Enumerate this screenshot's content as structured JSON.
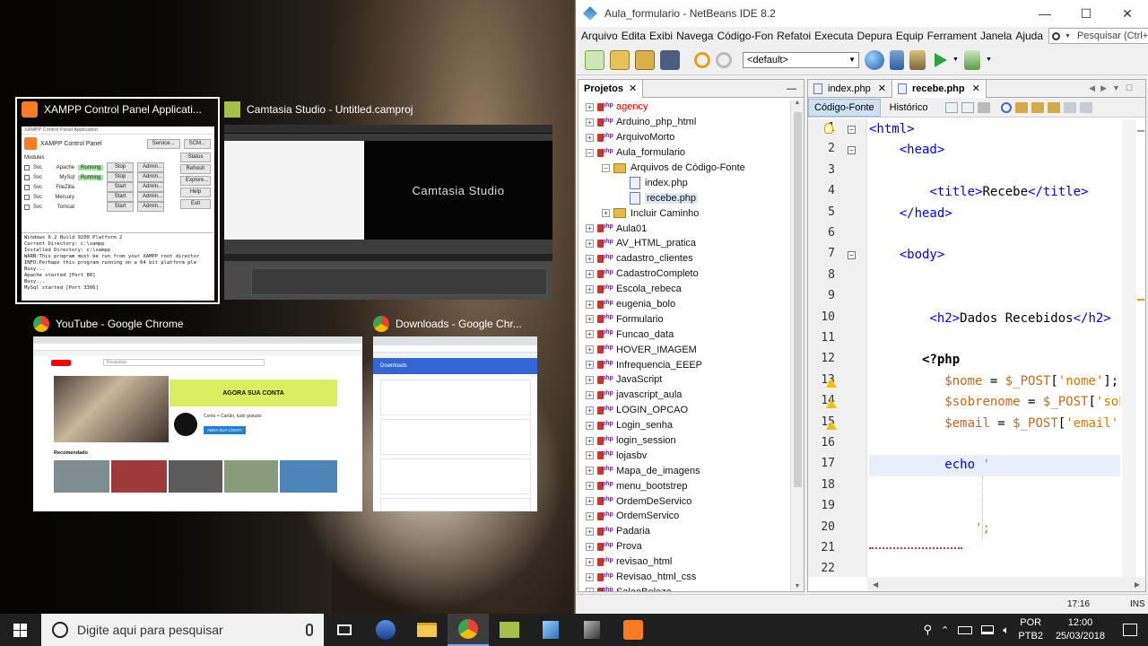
{
  "task_view": {
    "xampp": {
      "title": "XAMPP Control Panel Applicati...",
      "inner_title": "XAMPP Control Panel Application",
      "panel_label": "XAMPP Control Panel",
      "service_btn": "Service...",
      "scm_btn": "SCM...",
      "modules_label": "Modules",
      "svc": "Svc",
      "side_buttons": [
        "Status",
        "Refresh",
        "Explore...",
        "Help",
        "Exit"
      ],
      "modules": [
        {
          "name": "Apache",
          "status": "Running",
          "action": "Stop",
          "admin": "Admin..."
        },
        {
          "name": "MySql",
          "status": "Running",
          "action": "Stop",
          "admin": "Admin..."
        },
        {
          "name": "FileZilla",
          "status": "",
          "action": "Start",
          "admin": "Admin..."
        },
        {
          "name": "Mercury",
          "status": "",
          "action": "Start",
          "admin": "Admin..."
        },
        {
          "name": "Tomcat",
          "status": "",
          "action": "Start",
          "admin": "Admin..."
        }
      ],
      "log": [
        "Windows 6.2 Build 9200 Platform 2",
        "Current Directory: c:\\xampp",
        "Installed Directory: c:\\xampp",
        "WARN:This program must be run from your XAMPP root director",
        "INFO:Perhaps this program running on a 64 bit platform ple",
        "Busy...",
        "Apache started [Port 80]",
        "Busy...",
        "MySql started [Port 3306]"
      ]
    },
    "camtasia": {
      "title": "Camtasia Studio - Untitled.camproj",
      "logo": "Camtasia Studio"
    },
    "youtube": {
      "title": "YouTube - Google Chrome",
      "search_placeholder": "Pesquisar",
      "banner": "AGORA SUA CONTA",
      "promo": "Conta + Cartão, tudo gratuito",
      "cta": "ABRA SUA CONTA",
      "section": "Recomendado"
    },
    "downloads": {
      "title": "Downloads - Google Chr...",
      "header": "Downloads"
    }
  },
  "netbeans": {
    "title": "Aula_formulario - NetBeans IDE 8.2",
    "window_controls": [
      "—",
      "☐",
      "✕"
    ],
    "menu": [
      "Arquivo",
      "Editar",
      "Exibir",
      "Navegar",
      "Código-Fonte",
      "Refatorar",
      "Executar",
      "Depurar",
      "Equipe",
      "Ferramentas",
      "Janela",
      "Ajuda"
    ],
    "menu_visible": [
      "Arquivo",
      "Edita",
      "Exibi",
      "Navega",
      "Código-Fon",
      "Refatoi",
      "Executa",
      "Depura",
      "Equip",
      "Ferrament",
      "Janela",
      "Ajuda"
    ],
    "search_placeholder": "Pesquisar (Ctrl+I)",
    "config_combo": "<default>",
    "projects_tab": "Projetos",
    "projects": [
      {
        "label": "agency",
        "level": 0,
        "type": "project",
        "error": true
      },
      {
        "label": "Arduino_php_html",
        "level": 0,
        "type": "project"
      },
      {
        "label": "ArquivoMorto",
        "level": 0,
        "type": "project"
      },
      {
        "label": "Aula_formulario",
        "level": 0,
        "type": "project",
        "expanded": true
      },
      {
        "label": "Arquivos de Código-Fonte",
        "level": 1,
        "type": "folder",
        "expanded": true
      },
      {
        "label": "index.php",
        "level": 2,
        "type": "file"
      },
      {
        "label": "recebe.php",
        "level": 2,
        "type": "file",
        "selected": true
      },
      {
        "label": "Incluir Caminho",
        "level": 1,
        "type": "folder"
      },
      {
        "label": "Aula01",
        "level": 0,
        "type": "project"
      },
      {
        "label": "AV_HTML_pratica",
        "level": 0,
        "type": "project"
      },
      {
        "label": "cadastro_clientes",
        "level": 0,
        "type": "project"
      },
      {
        "label": "CadastroCompleto",
        "level": 0,
        "type": "project"
      },
      {
        "label": "Escola_rebeca",
        "level": 0,
        "type": "project"
      },
      {
        "label": "eugenia_bolo",
        "level": 0,
        "type": "project"
      },
      {
        "label": "Formulario",
        "level": 0,
        "type": "project"
      },
      {
        "label": "Funcao_data",
        "level": 0,
        "type": "project"
      },
      {
        "label": "HOVER_IMAGEM",
        "level": 0,
        "type": "project"
      },
      {
        "label": "Infrequencia_EEEP",
        "level": 0,
        "type": "project"
      },
      {
        "label": "JavaScript",
        "level": 0,
        "type": "project"
      },
      {
        "label": "javascript_aula",
        "level": 0,
        "type": "project"
      },
      {
        "label": "LOGIN_OPCAO",
        "level": 0,
        "type": "project"
      },
      {
        "label": "Login_senha",
        "level": 0,
        "type": "project"
      },
      {
        "label": "login_session",
        "level": 0,
        "type": "project"
      },
      {
        "label": "lojasbv",
        "level": 0,
        "type": "project"
      },
      {
        "label": "Mapa_de_imagens",
        "level": 0,
        "type": "project"
      },
      {
        "label": "menu_bootstrep",
        "level": 0,
        "type": "project"
      },
      {
        "label": "OrdemDeServico",
        "level": 0,
        "type": "project"
      },
      {
        "label": "OrdemServico",
        "level": 0,
        "type": "project"
      },
      {
        "label": "Padaria",
        "level": 0,
        "type": "project"
      },
      {
        "label": "Prova",
        "level": 0,
        "type": "project"
      },
      {
        "label": "revisao_html",
        "level": 0,
        "type": "project"
      },
      {
        "label": "Revisao_html_css",
        "level": 0,
        "type": "project"
      },
      {
        "label": "SalaoBeleza",
        "level": 0,
        "type": "project"
      }
    ],
    "editor_tabs": [
      {
        "label": "index.php",
        "active": false
      },
      {
        "label": "recebe.php",
        "active": true
      }
    ],
    "subtabs": [
      "Código-Fonte",
      "Histórico"
    ],
    "line_numbers": [
      "1",
      "2",
      "3",
      "4",
      "5",
      "6",
      "7",
      "8",
      "9",
      "10",
      "11",
      "12",
      "13",
      "14",
      "15",
      "16",
      "17",
      "18",
      "19",
      "20",
      "21",
      "22"
    ],
    "code_lines": [
      {
        "n": "1",
        "text": "<html>"
      },
      {
        "n": "2",
        "text": "    <head>"
      },
      {
        "n": "3",
        "text": ""
      },
      {
        "n": "4",
        "text": "        <title>Recebe</title>"
      },
      {
        "n": "5",
        "text": "    </head>"
      },
      {
        "n": "6",
        "text": ""
      },
      {
        "n": "7",
        "text": "    <body>"
      },
      {
        "n": "8",
        "text": ""
      },
      {
        "n": "9",
        "text": ""
      },
      {
        "n": "10",
        "text": "        <h2>Dados Recebidos</h2>"
      },
      {
        "n": "11",
        "text": ""
      },
      {
        "n": "12",
        "text": "       <?php"
      },
      {
        "n": "13",
        "text": "          $nome = $_POST['nome'];"
      },
      {
        "n": "14",
        "text": "          $sobrenome = $_POST['sobrenome'];"
      },
      {
        "n": "15",
        "text": "          $email = $_POST['email'];"
      },
      {
        "n": "16",
        "text": ""
      },
      {
        "n": "17",
        "text": "          echo '"
      },
      {
        "n": "18",
        "text": ""
      },
      {
        "n": "19",
        "text": ""
      },
      {
        "n": "20",
        "text": "              ';"
      },
      {
        "n": "21",
        "text": ""
      },
      {
        "n": "22",
        "text": ""
      }
    ],
    "status_position": "17:16",
    "status_mode": "INS"
  },
  "taskbar": {
    "search_placeholder": "Digite aqui para pesquisar",
    "lang": "POR",
    "layout": "PTB2",
    "time": "12:00",
    "date": "25/03/2018",
    "apps": [
      "task-view-icon",
      "browser-icon",
      "explorer-icon",
      "chrome-icon",
      "camtasia-icon",
      "virtualbox-icon",
      "netbeans-icon",
      "xampp-icon"
    ]
  }
}
